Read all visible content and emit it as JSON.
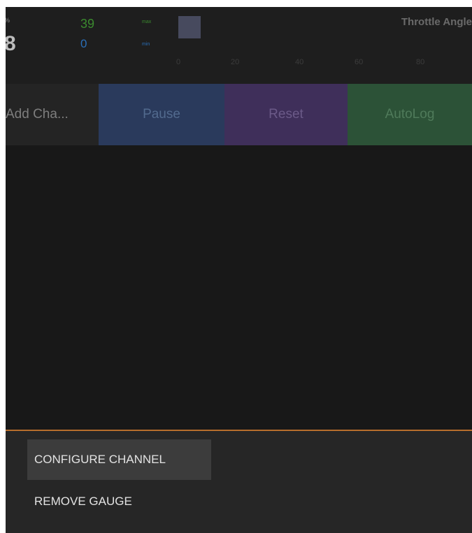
{
  "gauge": {
    "unit": "%",
    "current_value": "8",
    "max_value": "39",
    "min_value": "0",
    "max_tag": "max",
    "min_tag": "min",
    "title": "Throttle Angle",
    "scale_ticks": [
      "0",
      "20",
      "40",
      "60",
      "80"
    ],
    "colors": {
      "max": "#3b8a2e",
      "min": "#2a6fb8",
      "level": "#474a5e"
    }
  },
  "actions": {
    "add_channel_label": "Add Cha...",
    "pause_label": "Pause",
    "reset_label": "Reset",
    "autolog_label": "AutoLog",
    "colors": {
      "pause": "#2a3a5c",
      "reset": "#3f2f5a",
      "autolog": "#2c5237"
    }
  },
  "divider_color": "#b76e2c",
  "menu": {
    "configure_channel_label": "CONFIGURE CHANNEL",
    "remove_gauge_label": "REMOVE GAUGE"
  }
}
